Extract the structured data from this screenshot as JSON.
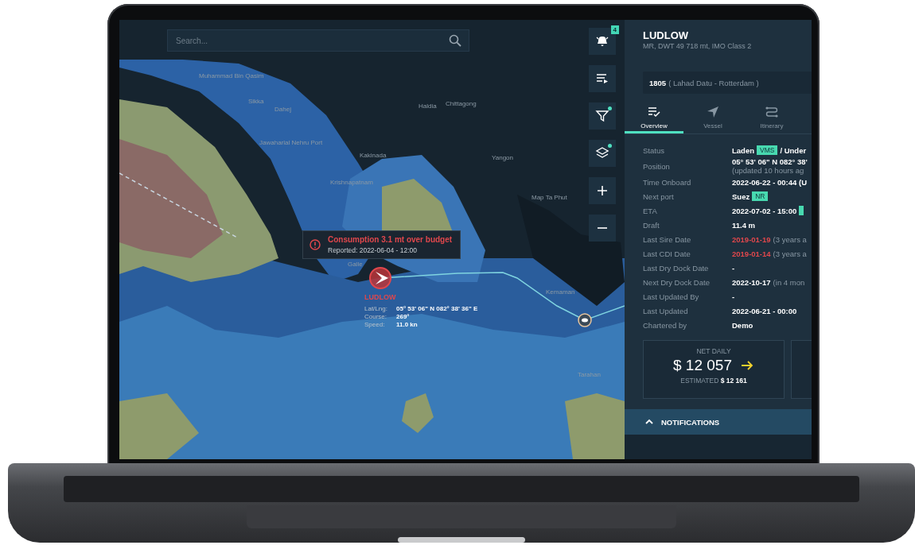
{
  "search": {
    "placeholder": "Search..."
  },
  "map_controls": [
    {
      "kind": "alerts",
      "badge": "4"
    },
    {
      "kind": "route-list"
    },
    {
      "kind": "filter",
      "indicator": true
    },
    {
      "kind": "layers",
      "indicator": true
    },
    {
      "kind": "zoom-in"
    },
    {
      "kind": "zoom-out"
    }
  ],
  "map": {
    "place_labels": [
      "Muhammad Bin Qasim",
      "Sikka",
      "Dahej",
      "Jawaharlal Nehru Port",
      "Haldia",
      "Chittagong",
      "Kakinada",
      "Krishnapatnam",
      "Yangon",
      "Map Ta Phut",
      "Galle",
      "Kemaman",
      "Tarahan"
    ],
    "alert": {
      "title": "Consumption 3.1 mt over budget",
      "reported": "Reported: 2022-06-04 - 12:00"
    },
    "vessel": {
      "name": "LUDLOW",
      "details": [
        {
          "label": "Lat/Lng:",
          "value": "05° 53' 06\" N 082° 38' 36\" E"
        },
        {
          "label": "Course:",
          "value": "269°"
        },
        {
          "label": "Speed:",
          "value": "11.0 kn"
        }
      ]
    }
  },
  "panel": {
    "vessel_name": "LUDLOW",
    "vessel_subtitle": "MR, DWT 49 718 mt, IMO Class 2",
    "voyage": {
      "number": "1805",
      "route": "( Lahad Datu - Rotterdam )"
    },
    "tabs": [
      {
        "label": "Overview",
        "kind": "overview",
        "selected": true
      },
      {
        "label": "Vessel",
        "kind": "vessel",
        "selected": false
      },
      {
        "label": "Itinerary",
        "kind": "itinerary",
        "selected": false
      }
    ],
    "fields": [
      {
        "label": "Status",
        "value": [
          {
            "kind": "text",
            "text": "Laden"
          },
          {
            "kind": "badge",
            "text": "VMS"
          },
          {
            "kind": "text",
            "text": "/ Under"
          }
        ]
      },
      {
        "label": "Position",
        "value": [
          {
            "kind": "text",
            "text": "05° 53' 06\" N 082° 38'"
          },
          {
            "kind": "subline",
            "text": "(updated 10 hours ag"
          }
        ]
      },
      {
        "label": "Time Onboard",
        "value": [
          {
            "kind": "text",
            "text": "2022-06-22 - 00:44 (U"
          }
        ]
      },
      {
        "label": "Next port",
        "value": [
          {
            "kind": "text",
            "text": "Suez"
          },
          {
            "kind": "badge",
            "text": "NR"
          }
        ]
      },
      {
        "label": "ETA",
        "value": [
          {
            "kind": "text",
            "text": "2022-07-02 - 15:00"
          },
          {
            "kind": "flag"
          }
        ]
      },
      {
        "label": "Draft",
        "value": [
          {
            "kind": "text",
            "text": "11.4 m"
          }
        ]
      },
      {
        "label": "Last Sire Date",
        "value": [
          {
            "kind": "alert",
            "text": "2019-01-19"
          },
          {
            "kind": "muted",
            "text": "(3 years a"
          }
        ]
      },
      {
        "label": "Last CDI Date",
        "value": [
          {
            "kind": "alert",
            "text": "2019-01-14"
          },
          {
            "kind": "muted",
            "text": "(3 years a"
          }
        ]
      },
      {
        "label": "Last Dry Dock Date",
        "value": [
          {
            "kind": "text",
            "text": "-"
          }
        ]
      },
      {
        "label": "Next Dry Dock Date",
        "value": [
          {
            "kind": "text",
            "text": "2022-10-17"
          },
          {
            "kind": "muted",
            "text": "(in 4 mon"
          }
        ]
      },
      {
        "label": "Last Updated By",
        "value": [
          {
            "kind": "text",
            "text": "-"
          }
        ]
      },
      {
        "label": "Last Updated",
        "value": [
          {
            "kind": "text",
            "text": "2022-06-21 - 00:00"
          }
        ]
      },
      {
        "label": "Chartered by",
        "value": [
          {
            "kind": "text",
            "text": "Demo"
          }
        ]
      }
    ],
    "cards": [
      {
        "title": "NET DAILY",
        "amount": "$ 12 057",
        "kind": "flat",
        "estimate": "ESTIMATED **$ 12 161**"
      }
    ],
    "notifications": {
      "title": "NOTIFICATIONS",
      "expanded": true
    }
  }
}
